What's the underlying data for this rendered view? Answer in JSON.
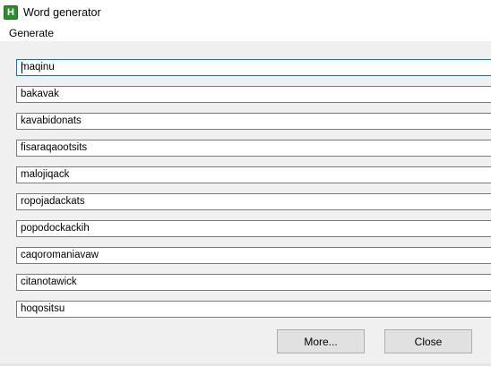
{
  "window": {
    "title": "Word generator",
    "icon_glyph": "H"
  },
  "menu": {
    "items": [
      "Generate"
    ]
  },
  "words": [
    "maqinu",
    "bakavak",
    "kavabidonats",
    "fisaraqaootsits",
    "malojiqack",
    "ropojadackats",
    "popodockackih",
    "caqoromaniavaw",
    "citanotawick",
    "hoqositsu"
  ],
  "buttons": {
    "more_label": "More...",
    "close_label": "Close"
  },
  "colors": {
    "focus_border": "#0078d7",
    "app_icon": "#2e8b2e"
  }
}
